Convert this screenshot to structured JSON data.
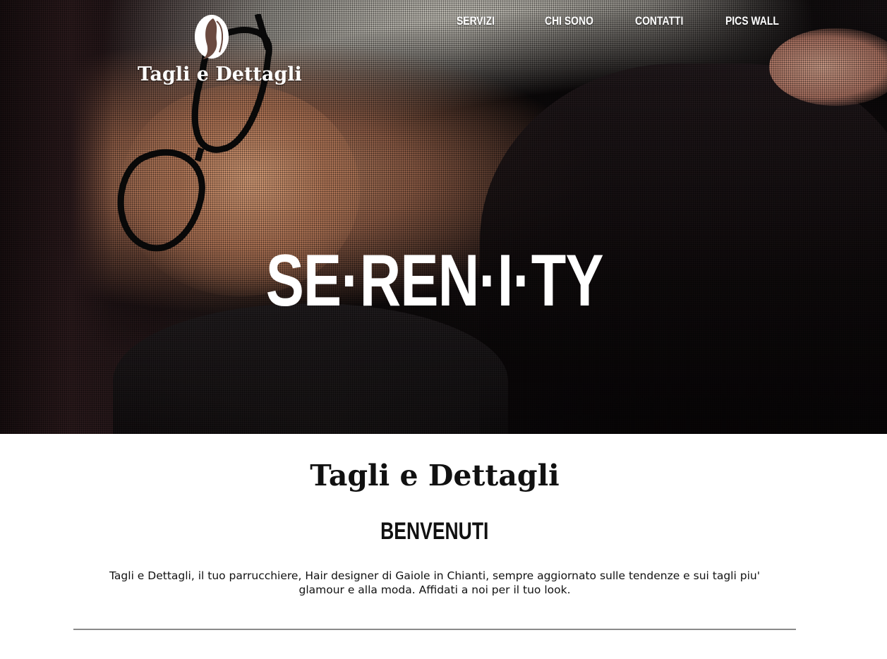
{
  "hero": {
    "title": "SE·REN·I·TY"
  },
  "logo": {
    "text": "Tagli e Dettagli",
    "icon": "woman-silhouette-icon"
  },
  "nav": {
    "items": [
      {
        "label": "SERVIZI"
      },
      {
        "label": "CHI SONO"
      },
      {
        "label": "CONTATTI"
      },
      {
        "label": "PICS WALL"
      }
    ]
  },
  "content": {
    "brand_title": "Tagli e Dettagli",
    "welcome": "BENVENUTI",
    "intro": "Tagli e Dettagli, il tuo parrucchiere, Hair designer di Gaiole in Chianti, sempre aggiornato sulle tendenze e sui tagli piu' glamour e alla moda. Affidati a noi per il tuo look."
  },
  "colors": {
    "text_dark": "#111111",
    "divider": "#8a8a8a",
    "nav_text": "#ffffff"
  }
}
